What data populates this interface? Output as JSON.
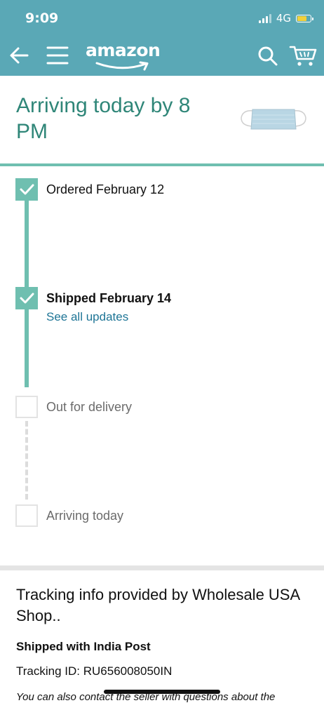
{
  "status_bar": {
    "time": "9:09",
    "network": "4G",
    "battery_level": 0.75
  },
  "nav": {
    "logo": "amazon",
    "back_icon": "back-arrow-icon",
    "menu_icon": "hamburger-menu-icon",
    "search_icon": "search-icon",
    "cart_icon": "cart-icon"
  },
  "arrival": {
    "title": "Arriving today by 8 PM",
    "product_image": "face-mask-product-image"
  },
  "steps": [
    {
      "label": "Ordered February 12",
      "status": "done"
    },
    {
      "label": "Shipped February 14",
      "status": "done",
      "link": "See all updates"
    },
    {
      "label": "Out for delivery",
      "status": "pending"
    },
    {
      "label": "Arriving today",
      "status": "pending"
    }
  ],
  "tracking": {
    "provider_text": "Tracking info provided by Wholesale USA Shop..",
    "carrier": "Shipped with India Post",
    "tracking_id": "Tracking ID: RU656008050IN",
    "contact_note": "You can also contact the seller with questions about the"
  },
  "colors": {
    "header": "#5aa8b6",
    "accent_teal": "#2f8678",
    "progress": "#6fbfb0",
    "link": "#1e7596"
  }
}
